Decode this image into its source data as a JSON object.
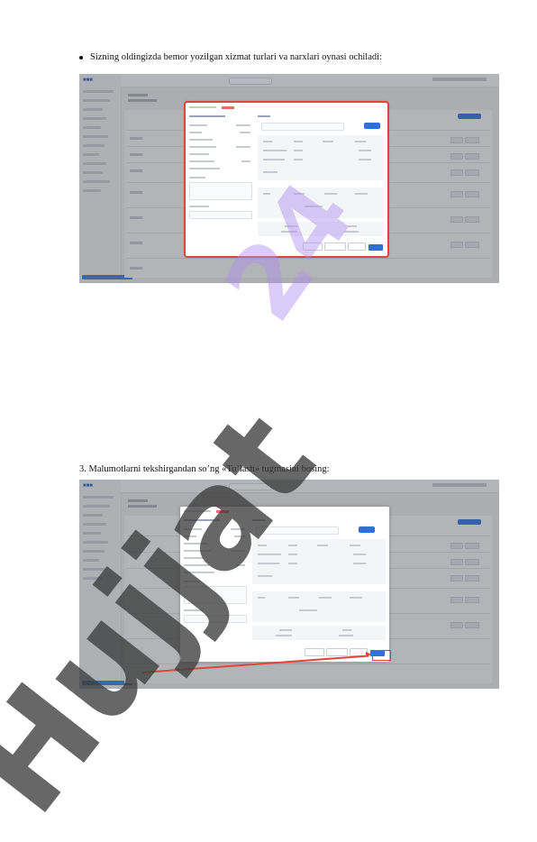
{
  "doc": {
    "bullet_text": "Sizning oldingizda bemor yozilgan xizmat turlari va narxlari oynasi ochiladi:",
    "step3_text": "3. Malumotlarni tekshirgandan so’ng «To’lash» tugmasini bosing:"
  },
  "watermark": {
    "text_dark": "Hujjat",
    "text_purple": "24"
  },
  "colors": {
    "accent_red": "#e0453b",
    "primary_blue": "#2f6fd8",
    "watermark_dark": "#3c3c3c",
    "watermark_purple": "#af8cf0"
  },
  "screenshot1": {
    "modal_highlight": "red-outline"
  },
  "screenshot2": {
    "pay_button_highlight": "red-box-with-arrow"
  }
}
